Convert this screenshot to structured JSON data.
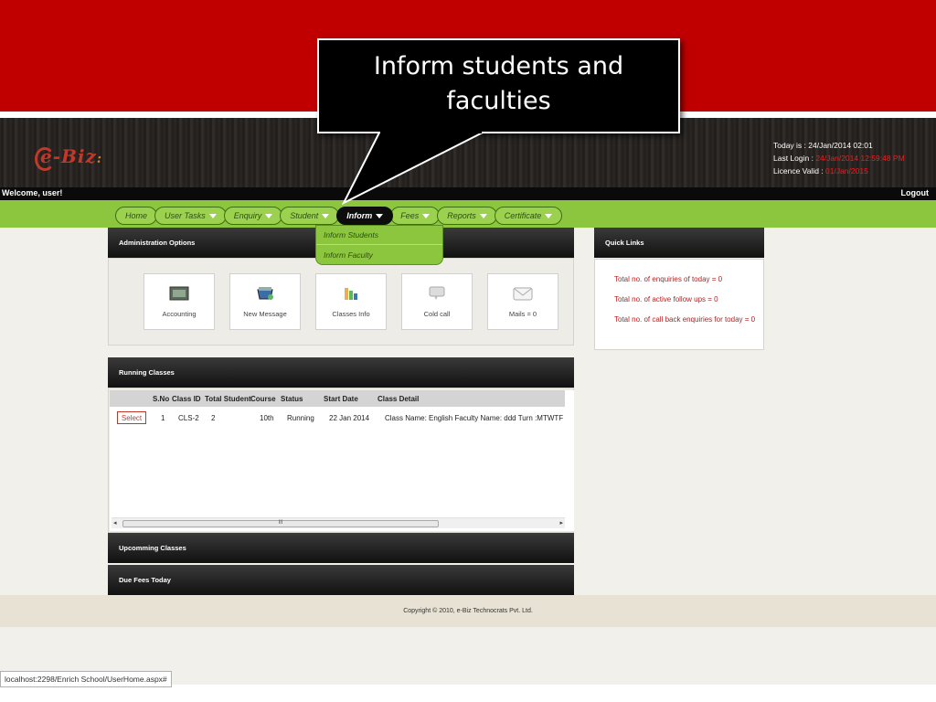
{
  "callout": {
    "text": "Inform students and faculties"
  },
  "header": {
    "logo": "e-Biz",
    "today": "Today is : 24/Jan/2014 02:01",
    "last_login_label": "Last Login : ",
    "last_login_value": "24/Jan/2014 12:59:48 PM",
    "licence_label": "Licence Valid : ",
    "licence_value": "01/Jan/2015",
    "welcome": "Welcome,  user!",
    "logout": "Logout"
  },
  "nav": {
    "items": [
      {
        "label": "Home",
        "dropdown": false
      },
      {
        "label": "User Tasks",
        "dropdown": true
      },
      {
        "label": "Enquiry",
        "dropdown": true
      },
      {
        "label": "Student",
        "dropdown": true
      },
      {
        "label": "Inform",
        "dropdown": true,
        "active": true
      },
      {
        "label": "Fees",
        "dropdown": true
      },
      {
        "label": "Reports",
        "dropdown": true
      },
      {
        "label": "Certificate",
        "dropdown": true
      }
    ],
    "inform_menu": [
      "Inform Students",
      "Inform Faculty"
    ]
  },
  "admin": {
    "title": "Administration Options",
    "tiles": [
      {
        "label": "Accounting",
        "icon": "accounting-icon"
      },
      {
        "label": "New Message",
        "icon": "new-message-icon"
      },
      {
        "label": "Classes Info",
        "icon": "classes-info-icon"
      },
      {
        "label": "Cold call",
        "icon": "cold-call-icon"
      },
      {
        "label": "Mails = 0",
        "icon": "mail-icon"
      }
    ]
  },
  "quick_links": {
    "title": "Quick Links",
    "items": [
      "Total no. of enquiries of today = 0",
      "Total no. of active follow ups = 0",
      "Total no. of call back enquiries for today = 0"
    ]
  },
  "running_classes": {
    "title": "Running Classes",
    "columns": [
      "S.No",
      "Class ID",
      "Total Student",
      "Course",
      "Status",
      "Start Date",
      "Class Detail"
    ],
    "rows": [
      {
        "action": "Select",
        "sno": "1",
        "class_id": "CLS-2",
        "total": "2",
        "course": "10th",
        "status": "Running",
        "start": "22 Jan 2014",
        "detail": "Class Name: English Faculty Name: ddd Turn :MTWTF"
      }
    ],
    "scroll_grip": "III"
  },
  "upcoming": {
    "title": "Upcomming Classes"
  },
  "due_fees": {
    "title": "Due Fees Today"
  },
  "footer": {
    "copyright": "Copyright © 2010, e-Biz Technocrats Pvt. Ltd."
  },
  "status_bar": {
    "url": "localhost:2298/Enrich School/UserHome.aspx#"
  },
  "colors": {
    "brand_red": "#c00000",
    "nav_green": "#8cc63f",
    "link_red": "#b22222"
  }
}
